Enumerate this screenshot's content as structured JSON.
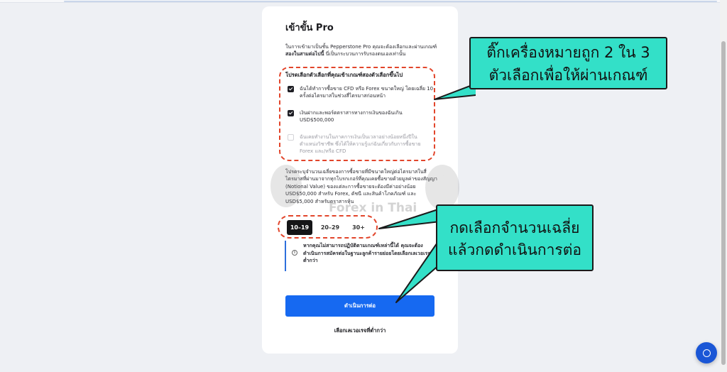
{
  "form": {
    "title": "เข้าขั้น Pro",
    "intro_prefix": "ในการเข้ามาเป็นชั้น Pepperstone Pro คุณจะต้องเลือกและผ่านเกณฑ์ ",
    "intro_bold": "สองในสามต่อไปนี้",
    "intro_suffix": " นี่เป็นกระบวนการรับรองตนเองเท่านั้น",
    "criteria_label": "โปรดเลือกตัวเลือกที่คุณเข้าเกณฑ์สองตัวเลือกขึ้นไป",
    "options": [
      {
        "label": "ฉันได้ทำการซื้อขาย CFD หรือ Forex ขนาดใหญ่ โดยเฉลี่ย 10 ครั้งต่อไตรมาสในช่วงสี่ไตรมาสก่อนหน้า",
        "checked": true
      },
      {
        "label": "เงินฝากและพอร์ตตราสารทางการเงินของฉันเกิน USD$500,000",
        "checked": true
      },
      {
        "label": "ฉันเคยทำงานในภาคการเงินเป็นเวลาอย่างน้อยหนึ่งปีในตำแหน่งวิชาชีพ ซึ่งได้ให้ความรู้แก่ฉันเกี่ยวกับการซื้อขาย Forex และ/หรือ CFD",
        "checked": false
      }
    ],
    "notional_text": "โปรดระบุจำนวนเฉลี่ยของการซื้อขายที่มีขนาดใหญ่ต่อไตรมาสในสี่ไตรมาสที่ผ่านมาจากทุกโบรกเกอร์ที่คุณเคยซื้อขายด้วยมูลค่าของสัญญา (Notional Value) ของแต่ละการซื้อขายจะต้องมีค่าอย่างน้อย USD$50,000 สำหรับ Forex, ดัชนี และสินค้าโภคภัณฑ์ และ USD$5,000 สำหรับตราสารหุ้น",
    "ranges": [
      "10–19",
      "20–29",
      "30+"
    ],
    "selected_range": "10–19",
    "notice_text": "หากคุณไม่สามารถปฏิบัติตามเกณฑ์เหล่านี้ได้ คุณจะต้องดำเนินการสมัครต่อในฐานะลูกค้ารายย่อยโดยเลือกเลเวอเรจที่ต่ำกว่า",
    "notice_icon": "info-icon",
    "continue_label": "ดำเนินการต่อ",
    "lower_leverage_label": "เลือกเลเวอเรจที่ต่ำกว่า"
  },
  "annotations": {
    "callout_1": [
      "ติ๊กเครื่องหมายถูก 2 ใน 3",
      "ตัวเลือกเพื่อให้ผ่านเกณฑ์"
    ],
    "callout_2": [
      "กดเลือกจำนวนเฉลี่ย",
      "แล้วกดดำเนินการต่อ"
    ],
    "watermark": "Forex in Thai"
  },
  "colors": {
    "primary": "#1669f1",
    "callout": "#33e0c8",
    "highlight": "#e2452b",
    "chat": "#1a56d6"
  },
  "chat_icon": "chat-bubble-icon"
}
